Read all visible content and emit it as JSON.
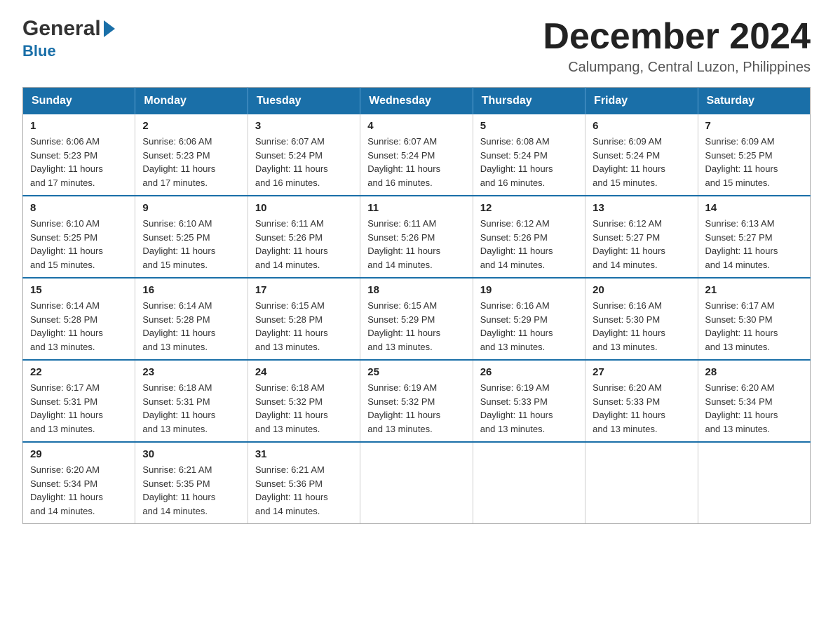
{
  "header": {
    "logo": {
      "general": "General",
      "blue": "Blue",
      "arrow_label": "logo-arrow"
    },
    "title": "December 2024",
    "location": "Calumpang, Central Luzon, Philippines"
  },
  "calendar": {
    "days_of_week": [
      "Sunday",
      "Monday",
      "Tuesday",
      "Wednesday",
      "Thursday",
      "Friday",
      "Saturday"
    ],
    "weeks": [
      [
        {
          "day": "1",
          "sunrise": "6:06 AM",
          "sunset": "5:23 PM",
          "daylight": "11 hours and 17 minutes."
        },
        {
          "day": "2",
          "sunrise": "6:06 AM",
          "sunset": "5:23 PM",
          "daylight": "11 hours and 17 minutes."
        },
        {
          "day": "3",
          "sunrise": "6:07 AM",
          "sunset": "5:24 PM",
          "daylight": "11 hours and 16 minutes."
        },
        {
          "day": "4",
          "sunrise": "6:07 AM",
          "sunset": "5:24 PM",
          "daylight": "11 hours and 16 minutes."
        },
        {
          "day": "5",
          "sunrise": "6:08 AM",
          "sunset": "5:24 PM",
          "daylight": "11 hours and 16 minutes."
        },
        {
          "day": "6",
          "sunrise": "6:09 AM",
          "sunset": "5:24 PM",
          "daylight": "11 hours and 15 minutes."
        },
        {
          "day": "7",
          "sunrise": "6:09 AM",
          "sunset": "5:25 PM",
          "daylight": "11 hours and 15 minutes."
        }
      ],
      [
        {
          "day": "8",
          "sunrise": "6:10 AM",
          "sunset": "5:25 PM",
          "daylight": "11 hours and 15 minutes."
        },
        {
          "day": "9",
          "sunrise": "6:10 AM",
          "sunset": "5:25 PM",
          "daylight": "11 hours and 15 minutes."
        },
        {
          "day": "10",
          "sunrise": "6:11 AM",
          "sunset": "5:26 PM",
          "daylight": "11 hours and 14 minutes."
        },
        {
          "day": "11",
          "sunrise": "6:11 AM",
          "sunset": "5:26 PM",
          "daylight": "11 hours and 14 minutes."
        },
        {
          "day": "12",
          "sunrise": "6:12 AM",
          "sunset": "5:26 PM",
          "daylight": "11 hours and 14 minutes."
        },
        {
          "day": "13",
          "sunrise": "6:12 AM",
          "sunset": "5:27 PM",
          "daylight": "11 hours and 14 minutes."
        },
        {
          "day": "14",
          "sunrise": "6:13 AM",
          "sunset": "5:27 PM",
          "daylight": "11 hours and 14 minutes."
        }
      ],
      [
        {
          "day": "15",
          "sunrise": "6:14 AM",
          "sunset": "5:28 PM",
          "daylight": "11 hours and 13 minutes."
        },
        {
          "day": "16",
          "sunrise": "6:14 AM",
          "sunset": "5:28 PM",
          "daylight": "11 hours and 13 minutes."
        },
        {
          "day": "17",
          "sunrise": "6:15 AM",
          "sunset": "5:28 PM",
          "daylight": "11 hours and 13 minutes."
        },
        {
          "day": "18",
          "sunrise": "6:15 AM",
          "sunset": "5:29 PM",
          "daylight": "11 hours and 13 minutes."
        },
        {
          "day": "19",
          "sunrise": "6:16 AM",
          "sunset": "5:29 PM",
          "daylight": "11 hours and 13 minutes."
        },
        {
          "day": "20",
          "sunrise": "6:16 AM",
          "sunset": "5:30 PM",
          "daylight": "11 hours and 13 minutes."
        },
        {
          "day": "21",
          "sunrise": "6:17 AM",
          "sunset": "5:30 PM",
          "daylight": "11 hours and 13 minutes."
        }
      ],
      [
        {
          "day": "22",
          "sunrise": "6:17 AM",
          "sunset": "5:31 PM",
          "daylight": "11 hours and 13 minutes."
        },
        {
          "day": "23",
          "sunrise": "6:18 AM",
          "sunset": "5:31 PM",
          "daylight": "11 hours and 13 minutes."
        },
        {
          "day": "24",
          "sunrise": "6:18 AM",
          "sunset": "5:32 PM",
          "daylight": "11 hours and 13 minutes."
        },
        {
          "day": "25",
          "sunrise": "6:19 AM",
          "sunset": "5:32 PM",
          "daylight": "11 hours and 13 minutes."
        },
        {
          "day": "26",
          "sunrise": "6:19 AM",
          "sunset": "5:33 PM",
          "daylight": "11 hours and 13 minutes."
        },
        {
          "day": "27",
          "sunrise": "6:20 AM",
          "sunset": "5:33 PM",
          "daylight": "11 hours and 13 minutes."
        },
        {
          "day": "28",
          "sunrise": "6:20 AM",
          "sunset": "5:34 PM",
          "daylight": "11 hours and 13 minutes."
        }
      ],
      [
        {
          "day": "29",
          "sunrise": "6:20 AM",
          "sunset": "5:34 PM",
          "daylight": "11 hours and 14 minutes."
        },
        {
          "day": "30",
          "sunrise": "6:21 AM",
          "sunset": "5:35 PM",
          "daylight": "11 hours and 14 minutes."
        },
        {
          "day": "31",
          "sunrise": "6:21 AM",
          "sunset": "5:36 PM",
          "daylight": "11 hours and 14 minutes."
        },
        null,
        null,
        null,
        null
      ]
    ]
  }
}
